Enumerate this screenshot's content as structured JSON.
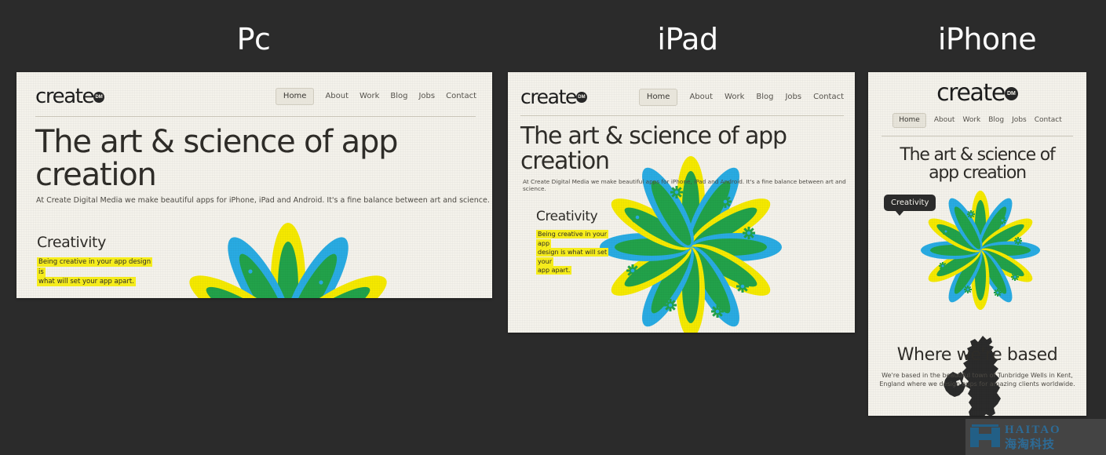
{
  "background_color": "#2b2b2b",
  "panel_color": "#f4f2eb",
  "accent_colors": {
    "blue": "#29abe2",
    "yellow": "#f5e900",
    "green": "#22a24a",
    "highlight": "#f5ec1c",
    "text_dark": "#2e2c28",
    "watermark_blue": "#2d6b96"
  },
  "devices": [
    {
      "id": "pc",
      "label": "Pc"
    },
    {
      "id": "ipad",
      "label": "iPad"
    },
    {
      "id": "iphone",
      "label": "iPhone"
    }
  ],
  "site": {
    "logo_text": "create",
    "logo_badge": "DM",
    "nav": [
      {
        "label": "Home",
        "active": true
      },
      {
        "label": "About",
        "active": false
      },
      {
        "label": "Work",
        "active": false
      },
      {
        "label": "Blog",
        "active": false
      },
      {
        "label": "Jobs",
        "active": false
      },
      {
        "label": "Contact",
        "active": false
      }
    ],
    "hero_title": "The art & science of app creation",
    "hero_title_line1": "The art & science of",
    "hero_title_line2": "app creation",
    "hero_subtitle": "At Create Digital Media we make beautiful apps for iPhone, iPad and Android. It's a fine balance between art and science.",
    "creativity_heading": "Creativity",
    "creativity_copy_pc_line1": "Being creative in your app design is",
    "creativity_copy_pc_line2": "what will set your app apart.",
    "creativity_copy_ipad_line1": "Being creative in your app",
    "creativity_copy_ipad_line2": "design is what will set your",
    "creativity_copy_ipad_line3": "app apart.",
    "based_heading": "Where we're based",
    "based_copy_line1": "We're based in the beautiful town of Tunbridge Wells in Kent,",
    "based_copy_line2": "England where we design apps for amazing clients worldwide."
  },
  "watermark": {
    "english": "HAITAO",
    "chinese": "海淘科技"
  }
}
